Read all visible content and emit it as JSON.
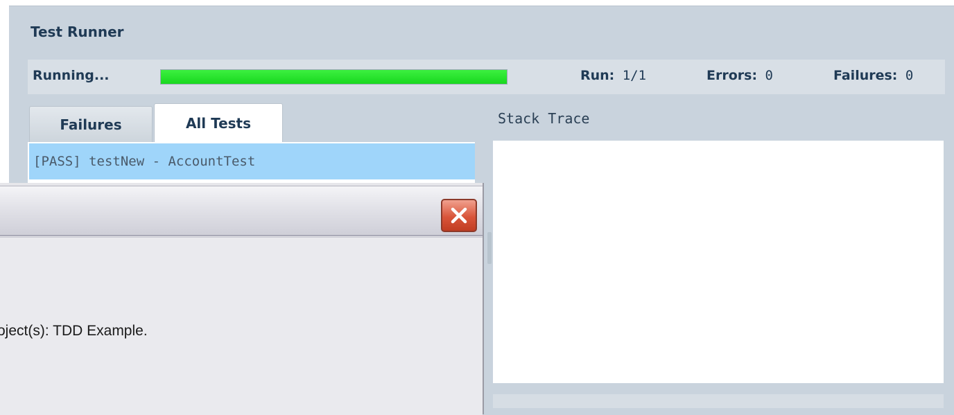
{
  "runner": {
    "title": "Test Runner",
    "status": "Running...",
    "progress": 1.0,
    "run_label": "Run:",
    "run_value": "1/1",
    "errors_label": "Errors:",
    "errors_value": "0",
    "failures_label": "Failures:",
    "failures_value": "0"
  },
  "tabs": [
    {
      "label": "Failures",
      "active": false
    },
    {
      "label": "All Tests",
      "active": true
    }
  ],
  "results": [
    {
      "text": "[PASS] testNew - AccountTest",
      "selected": true
    }
  ],
  "stack_trace": {
    "label": "Stack Trace"
  },
  "dialog": {
    "message": "oject(s): TDD Example.",
    "close_icon": "close-icon"
  },
  "colors": {
    "progress_green": "#19d81f",
    "selection_blue": "#9fd5fa",
    "runner_bg": "#c9d3dd",
    "close_red": "#d9553a"
  }
}
